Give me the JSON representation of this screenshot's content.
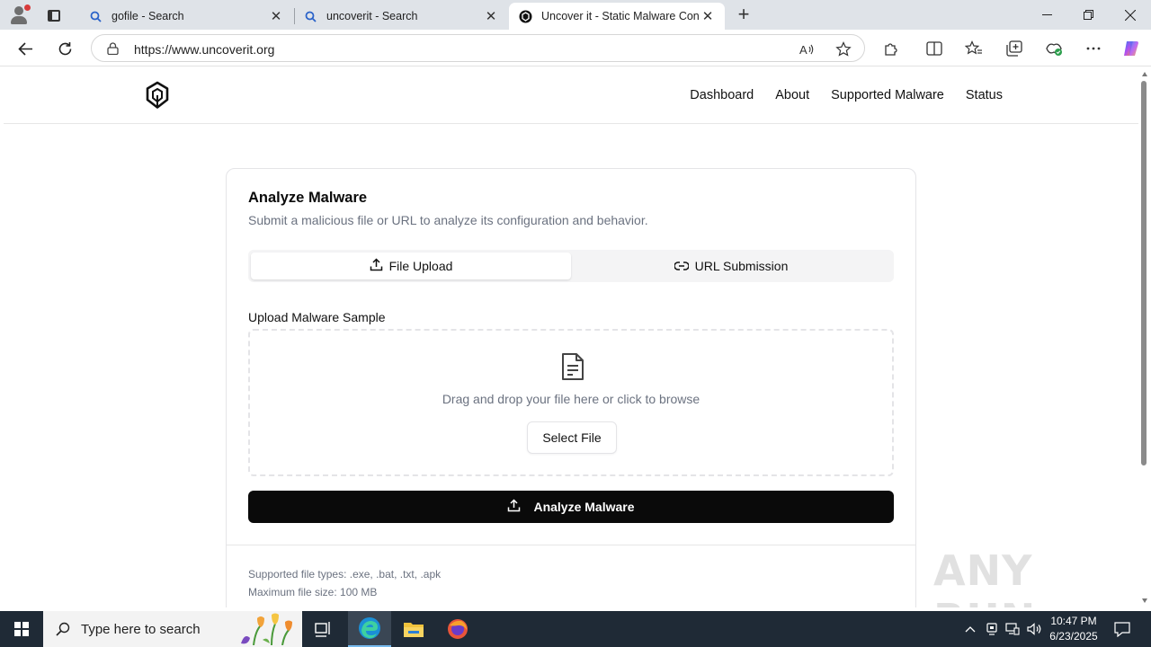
{
  "browser": {
    "tabs": [
      {
        "title": "gofile - Search"
      },
      {
        "title": "uncoverit - Search"
      },
      {
        "title": "Uncover it - Static Malware Config"
      }
    ],
    "url": "https://www.uncoverit.org"
  },
  "site": {
    "nav": [
      "Dashboard",
      "About",
      "Supported Malware",
      "Status"
    ]
  },
  "card": {
    "title": "Analyze Malware",
    "subtitle": "Submit a malicious file or URL to analyze its configuration and behavior.",
    "tabs": {
      "file_upload": "File Upload",
      "url_submission": "URL Submission"
    },
    "upload_label": "Upload Malware Sample",
    "dropzone_text": "Drag and drop your file here or click to browse",
    "select_button": "Select File",
    "analyze_button": "Analyze Malware",
    "supported_types": "Supported file types: .exe, .bat, .txt, .apk",
    "max_size": "Maximum file size: 100 MB"
  },
  "watermark": "ANY RUN",
  "taskbar": {
    "search_placeholder": "Type here to search",
    "time": "10:47 PM",
    "date": "6/23/2025"
  }
}
